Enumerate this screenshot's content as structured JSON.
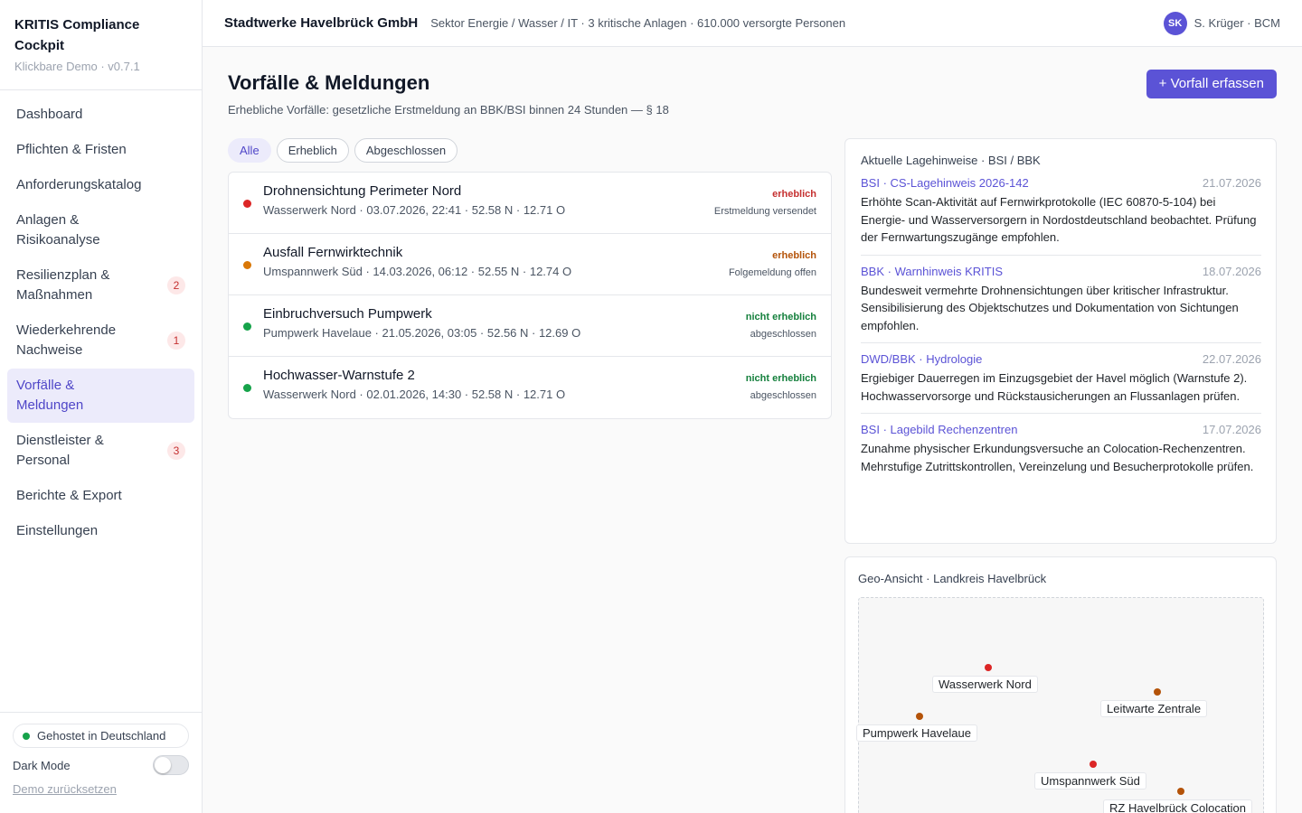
{
  "app": {
    "title": "KRITIS Compliance Cockpit",
    "subtitle": "Klickbare Demo · v0.7.1"
  },
  "nav": {
    "items": [
      {
        "label": "Dashboard",
        "badge": ""
      },
      {
        "label": "Pflichten & Fristen",
        "badge": ""
      },
      {
        "label": "Anforderungskatalog",
        "badge": ""
      },
      {
        "label": "Anlagen & Risikoanalyse",
        "badge": ""
      },
      {
        "label": "Resilienzplan & Maßnahmen",
        "badge": "2"
      },
      {
        "label": "Wiederkehrende Nachweise",
        "badge": "1"
      },
      {
        "label": "Vorfälle & Meldungen",
        "badge": "",
        "active": true
      },
      {
        "label": "Dienstleister & Personal",
        "badge": "3"
      },
      {
        "label": "Berichte & Export",
        "badge": ""
      },
      {
        "label": "Einstellungen",
        "badge": ""
      }
    ]
  },
  "footer": {
    "hosted": "Gehostet in Deutschland",
    "dark_mode": "Dark Mode",
    "reset": "Demo zurücksetzen"
  },
  "header": {
    "org": "Stadtwerke Havelbrück GmbH",
    "meta": "Sektor Energie / Wasser / IT · 3 kritische Anlagen · 610.000 versorgte Personen",
    "user_initials": "SK",
    "user_label": "S. Krüger · BCM"
  },
  "page": {
    "title": "Vorfälle & Meldungen",
    "subtitle": "Erhebliche Vorfälle: gesetzliche Erstmeldung an BBK/BSI binnen 24 Stunden — § 18",
    "new_button": "+ Vorfall erfassen"
  },
  "filters": [
    "Alle",
    "Erheblich",
    "Abgeschlossen"
  ],
  "incidents": [
    {
      "title": "Drohnensichtung Perimeter Nord",
      "meta": "Wasserwerk Nord · 03.07.2026, 22:41 · 52.58 N · 12.71 O",
      "severity": "erheblich",
      "status": "Erstmeldung versendet",
      "dot_color": "#dc2626",
      "sev_color": "#c53030"
    },
    {
      "title": "Ausfall Fernwirktechnik",
      "meta": "Umspannwerk Süd · 14.03.2026, 06:12 · 52.55 N · 12.74 O",
      "severity": "erheblich",
      "status": "Folgemeldung offen",
      "dot_color": "#d97706",
      "sev_color": "#b45309"
    },
    {
      "title": "Einbruchversuch Pumpwerk",
      "meta": "Pumpwerk Havelaue · 21.05.2026, 03:05 · 52.56 N · 12.69 O",
      "severity": "nicht erheblich",
      "status": "abgeschlossen",
      "dot_color": "#16a34a",
      "sev_color": "#15803d"
    },
    {
      "title": "Hochwasser-Warnstufe 2",
      "meta": "Wasserwerk Nord · 02.01.2026, 14:30 · 52.58 N · 12.71 O",
      "severity": "nicht erheblich",
      "status": "abgeschlossen",
      "dot_color": "#16a34a",
      "sev_color": "#15803d"
    }
  ],
  "notices": {
    "heading": "Aktuelle Lagehinweise · BSI / BBK",
    "items": [
      {
        "source": "BSI · CS-Lagehinweis 2026-142",
        "date": "21.07.2026",
        "text": "Erhöhte Scan-Aktivität auf Fernwirkprotokolle (IEC 60870-5-104) bei Energie- und Wasserversorgern in Nordostdeutschland beobachtet. Prüfung der Fernwartungszugänge empfohlen."
      },
      {
        "source": "BBK · Warnhinweis KRITIS",
        "date": "18.07.2026",
        "text": "Bundesweit vermehrte Drohnensichtungen über kritischer Infrastruktur. Sensibilisierung des Objektschutzes und Dokumentation von Sichtungen empfohlen."
      },
      {
        "source": "DWD/BBK · Hydrologie",
        "date": "22.07.2026",
        "text": "Ergiebiger Dauerregen im Einzugsgebiet der Havel möglich (Warnstufe 2). Hochwasservorsorge und Rückstausicherungen an Flussanlagen prüfen."
      },
      {
        "source": "BSI · Lagebild Rechenzentren",
        "date": "17.07.2026",
        "text": "Zunahme physischer Erkundungsversuche an Colocation-Rechenzentren. Mehrstufige Zutrittskontrollen, Vereinzelung und Besucherprotokolle prüfen."
      }
    ]
  },
  "geo": {
    "heading": "Geo-Ansicht · Landkreis Havelbrück",
    "sites": [
      {
        "label": "Wasserwerk Nord",
        "color": "#dc2626"
      },
      {
        "label": "Leitwarte Zentrale",
        "color": "#b45309"
      },
      {
        "label": "Pumpwerk Havelaue",
        "color": "#b45309"
      },
      {
        "label": "Umspannwerk Süd",
        "color": "#dc2626"
      },
      {
        "label": "RZ Havelbrück Colocation",
        "color": "#b45309"
      }
    ]
  }
}
